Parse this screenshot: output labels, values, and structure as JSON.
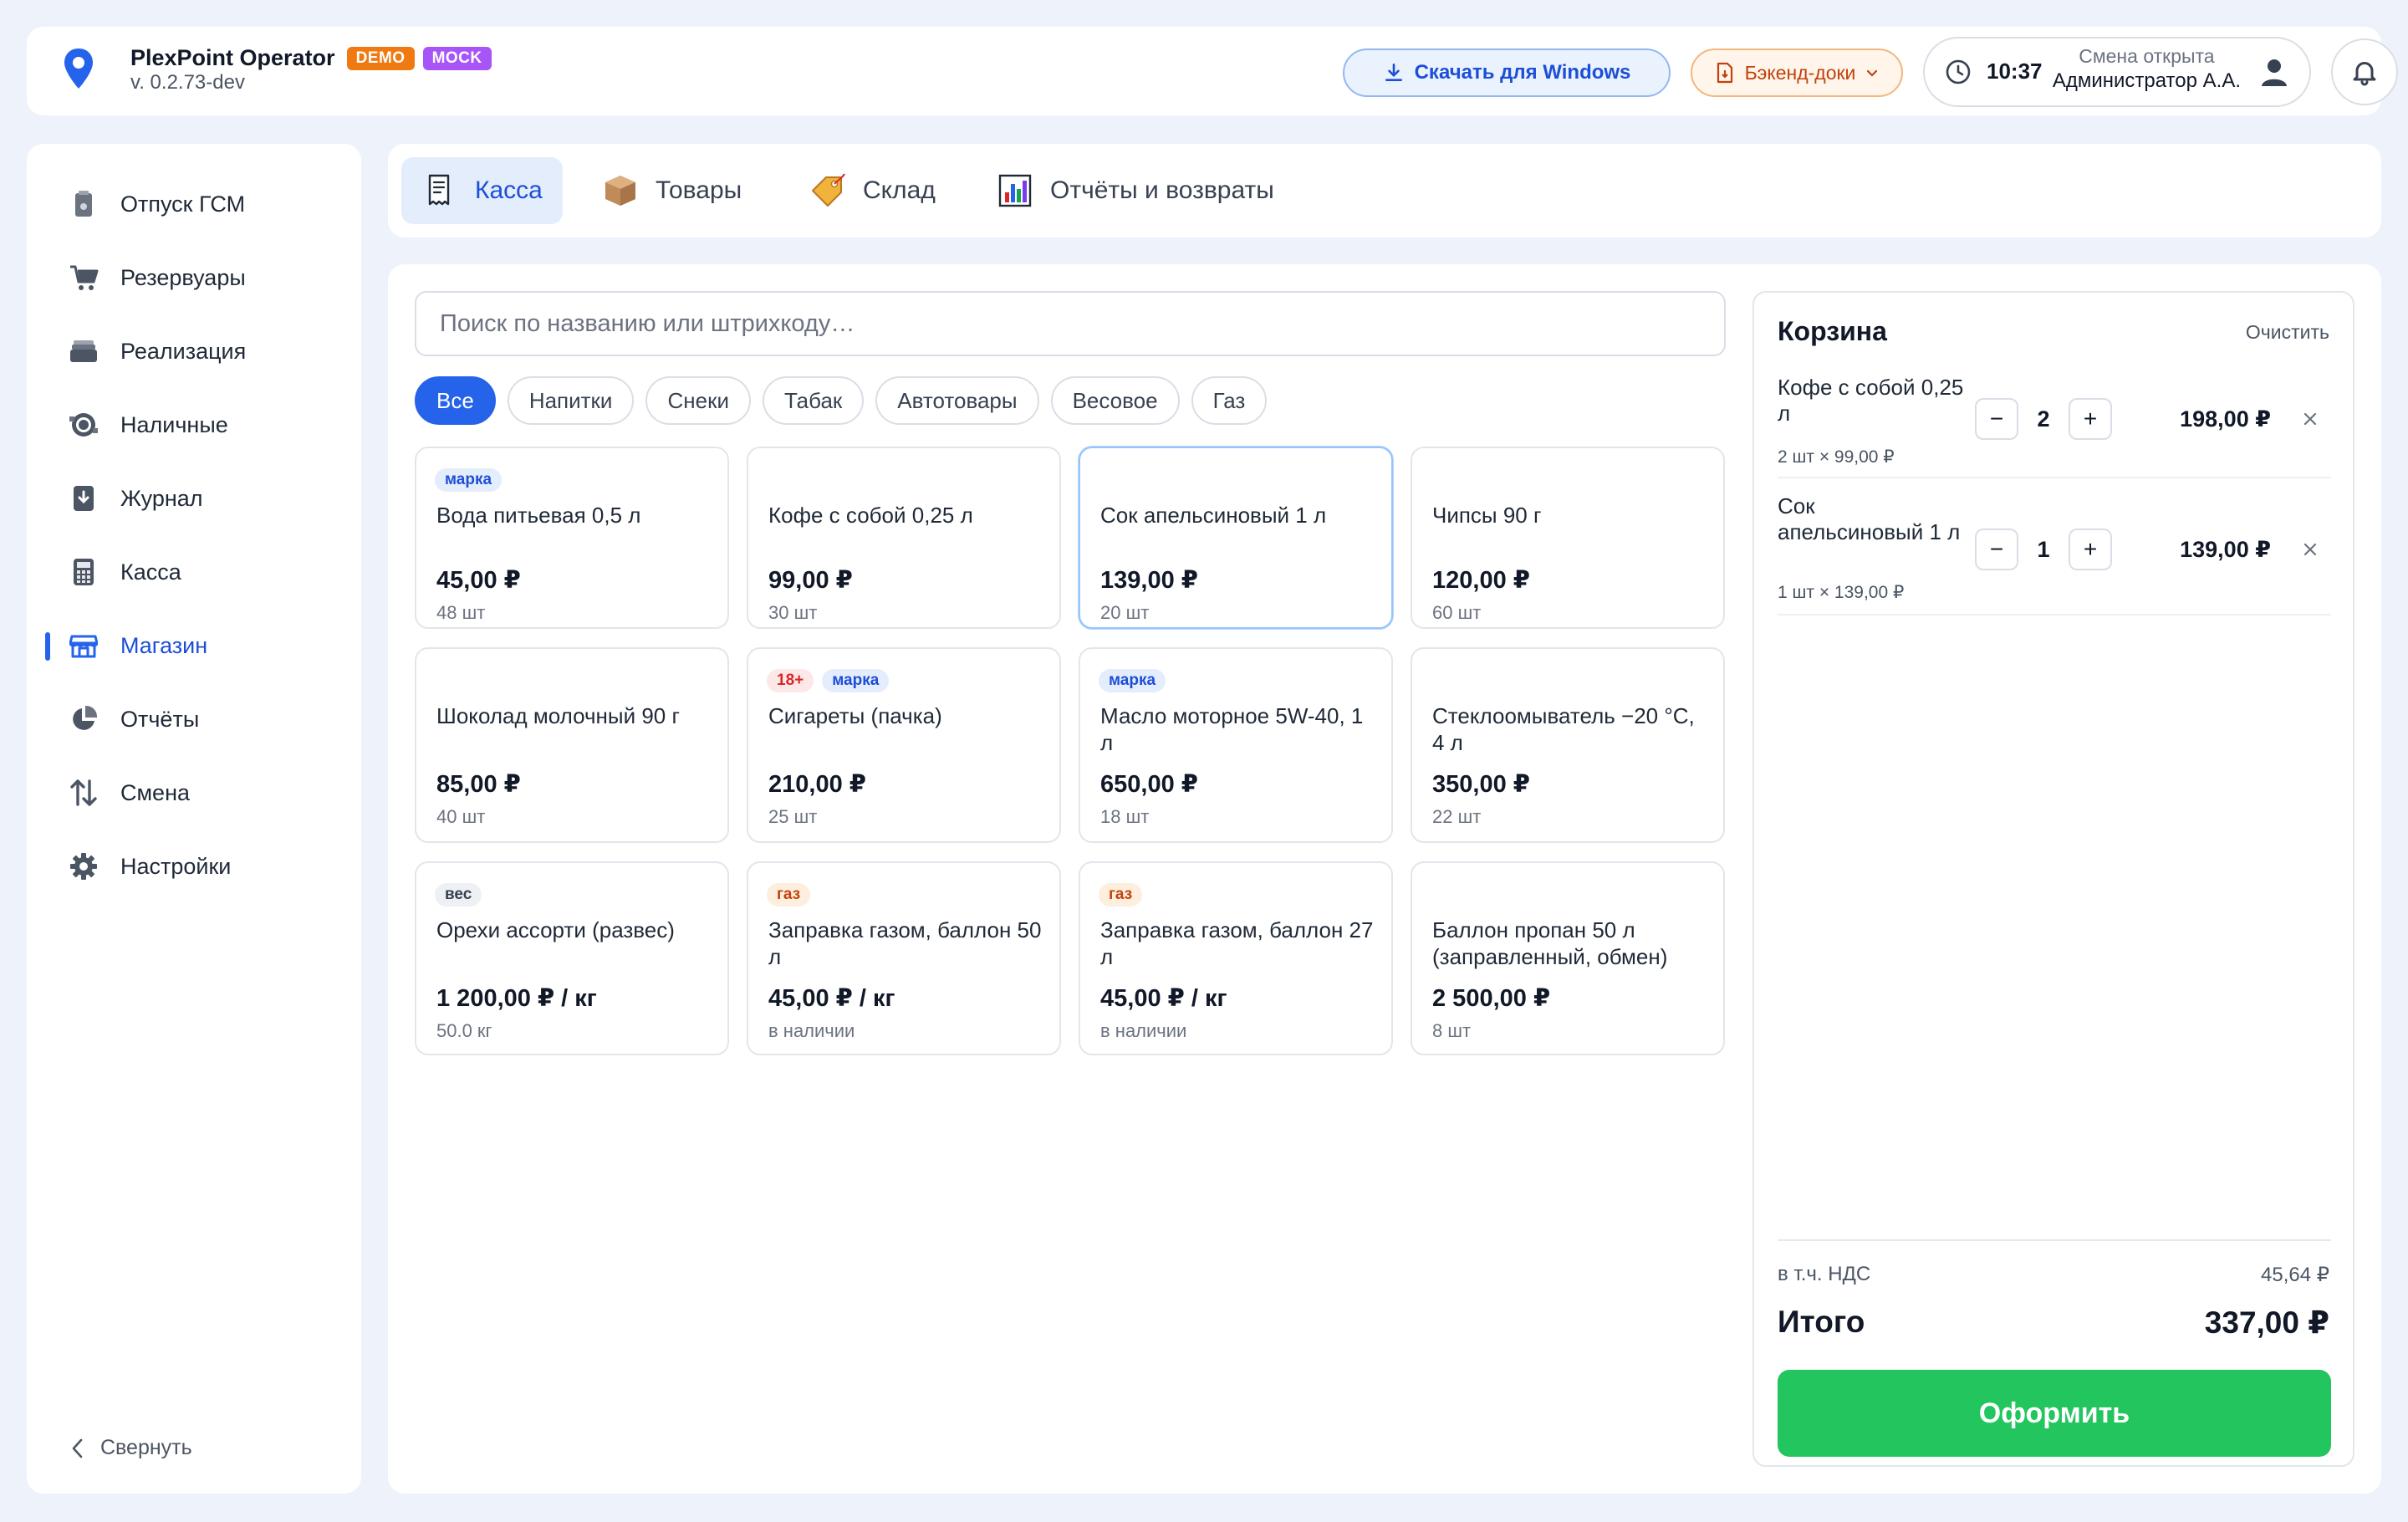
{
  "header": {
    "title": "PlexPoint Operator",
    "badge_demo": "DEMO",
    "badge_mock": "MOCK",
    "version": "v. 0.2.73-dev",
    "download_label": "Скачать для Windows",
    "docs_label": "Бэкенд-доки",
    "time": "10:37",
    "shift_status": "Смена открыта",
    "user": "Администратор А.А."
  },
  "sidebar": {
    "items": [
      {
        "label": "Отпуск ГСМ",
        "icon": "fuel-pump-icon"
      },
      {
        "label": "Резервуары",
        "icon": "cart-icon"
      },
      {
        "label": "Реализация",
        "icon": "inbox-tray-icon"
      },
      {
        "label": "Наличные",
        "icon": "cash-icon"
      },
      {
        "label": "Журнал",
        "icon": "journal-icon"
      },
      {
        "label": "Касса",
        "icon": "calculator-icon"
      },
      {
        "label": "Магазин",
        "icon": "store-icon"
      },
      {
        "label": "Отчёты",
        "icon": "pie-chart-icon"
      },
      {
        "label": "Смена",
        "icon": "swap-arrows-icon"
      },
      {
        "label": "Настройки",
        "icon": "gear-icon"
      }
    ],
    "active": "Магазин",
    "collapse_label": "Свернуть"
  },
  "tabs": [
    {
      "label": "Касса",
      "icon": "receipt-icon"
    },
    {
      "label": "Товары",
      "icon": "box-icon"
    },
    {
      "label": "Склад",
      "icon": "tag-icon"
    },
    {
      "label": "Отчёты и возвраты",
      "icon": "bar-chart-icon"
    }
  ],
  "search": {
    "placeholder": "Поиск по названию или штрихкоду…",
    "value": ""
  },
  "filters": [
    "Все",
    "Напитки",
    "Снеки",
    "Табак",
    "Автотовары",
    "Весовое",
    "Газ"
  ],
  "active_filter": "Все",
  "products": [
    {
      "name": "Вода питьевая 0,5 л",
      "price": "45,00 ₽",
      "stock": "48 шт",
      "tags": [
        {
          "text": "марка",
          "type": "marka"
        }
      ]
    },
    {
      "name": "Кофе с собой 0,25 л",
      "price": "99,00 ₽",
      "stock": "30 шт",
      "tags": []
    },
    {
      "name": "Сок апельсиновый 1 л",
      "price": "139,00 ₽",
      "stock": "20 шт",
      "tags": []
    },
    {
      "name": "Чипсы 90 г",
      "price": "120,00 ₽",
      "stock": "60 шт",
      "tags": []
    },
    {
      "name": "Шоколад молочный 90 г",
      "price": "85,00 ₽",
      "stock": "40 шт",
      "tags": []
    },
    {
      "name": "Сигареты (пачка)",
      "price": "210,00 ₽",
      "stock": "25 шт",
      "tags": [
        {
          "text": "18+",
          "type": "age"
        },
        {
          "text": "марка",
          "type": "marka"
        }
      ]
    },
    {
      "name": "Масло моторное 5W-40, 1 л",
      "price": "650,00 ₽",
      "stock": "18 шт",
      "tags": [
        {
          "text": "марка",
          "type": "marka"
        }
      ]
    },
    {
      "name": "Стеклоомыватель −20 °C, 4 л",
      "price": "350,00 ₽",
      "stock": "22 шт",
      "tags": []
    },
    {
      "name": "Орехи ассорти (развес)",
      "price": "1 200,00 ₽ / кг",
      "stock": "50.0 кг",
      "tags": [
        {
          "text": "вес",
          "type": "ves"
        }
      ]
    },
    {
      "name": "Заправка газом, баллон 50 л",
      "price": "45,00 ₽ / кг",
      "stock": "в наличии",
      "tags": [
        {
          "text": "газ",
          "type": "gaz"
        }
      ]
    },
    {
      "name": "Заправка газом, баллон 27 л",
      "price": "45,00 ₽ / кг",
      "stock": "в наличии",
      "tags": [
        {
          "text": "газ",
          "type": "gaz"
        }
      ]
    },
    {
      "name": "Баллон пропан 50 л (заправленный, обмен)",
      "price": "2 500,00 ₽",
      "stock": "8 шт",
      "tags": []
    }
  ],
  "cart": {
    "title": "Корзина",
    "clear_label": "Очистить",
    "items": [
      {
        "name": "Кофе с собой 0,25 л",
        "qty": "2",
        "detail": "2 шт × 99,00 ₽",
        "total": "198,00 ₽"
      },
      {
        "name": "Сок апельсиновый 1 л",
        "qty": "1",
        "detail": "1 шт × 139,00 ₽",
        "total": "139,00 ₽"
      }
    ],
    "vat_label": "в т.ч. НДС",
    "vat_value": "45,64 ₽",
    "total_label": "Итого",
    "total_value": "337,00 ₽",
    "checkout_label": "Оформить"
  },
  "colors": {
    "accent": "#2563eb",
    "success": "#22c55e",
    "demo_badge": "#f07a12",
    "mock_badge": "#a855f7"
  }
}
